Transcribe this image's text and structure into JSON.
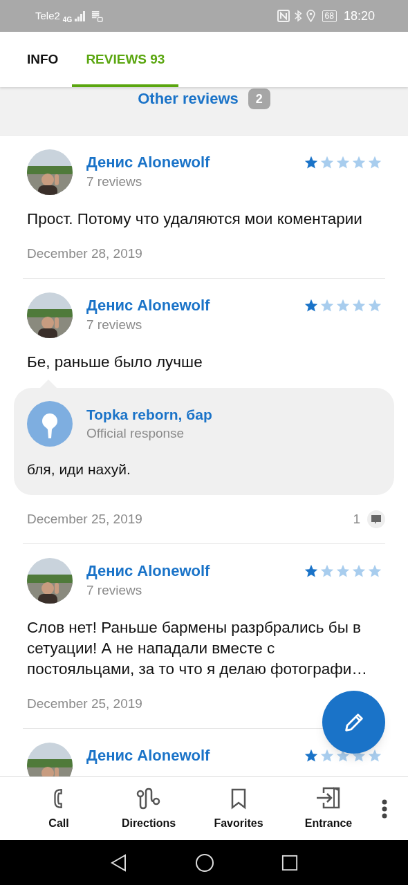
{
  "status_bar": {
    "carrier": "Tele2",
    "network": "4G",
    "battery": "68",
    "time": "18:20"
  },
  "tabs": [
    {
      "label": "INFO",
      "selected": false
    },
    {
      "label": "REVIEWS 93",
      "selected": true
    }
  ],
  "other_reviews": {
    "label": "Other reviews",
    "count": "2"
  },
  "reviews": [
    {
      "author": "Денис Alonewolf",
      "author_meta": "7 reviews",
      "stars": 1,
      "text": "Прост. Потому что удаляются мои коментарии",
      "date": "December 28, 2019"
    },
    {
      "author": "Денис Alonewolf",
      "author_meta": "7 reviews",
      "stars": 1,
      "text": "Бе, раньше было лучше",
      "response": {
        "author": "Topka reborn, бар",
        "label": "Official response",
        "text": "бля, иди нахуй."
      },
      "date": "December 25, 2019",
      "comments": "1"
    },
    {
      "author": "Денис Alonewolf",
      "author_meta": "7 reviews",
      "stars": 1,
      "text": "Слов нет! Раньше бармены разрбрались бы в сетуации! А не нападали вместе с постояльцами, за то что я делаю фотографи…",
      "date": "December 25, 2019"
    },
    {
      "author": "Денис Alonewolf",
      "stars": 1
    }
  ],
  "actions": [
    {
      "kind": "call",
      "label": "Call"
    },
    {
      "kind": "directions",
      "label": "Directions"
    },
    {
      "kind": "favorites",
      "label": "Favorites"
    },
    {
      "kind": "entrance",
      "label": "Entrance"
    }
  ]
}
